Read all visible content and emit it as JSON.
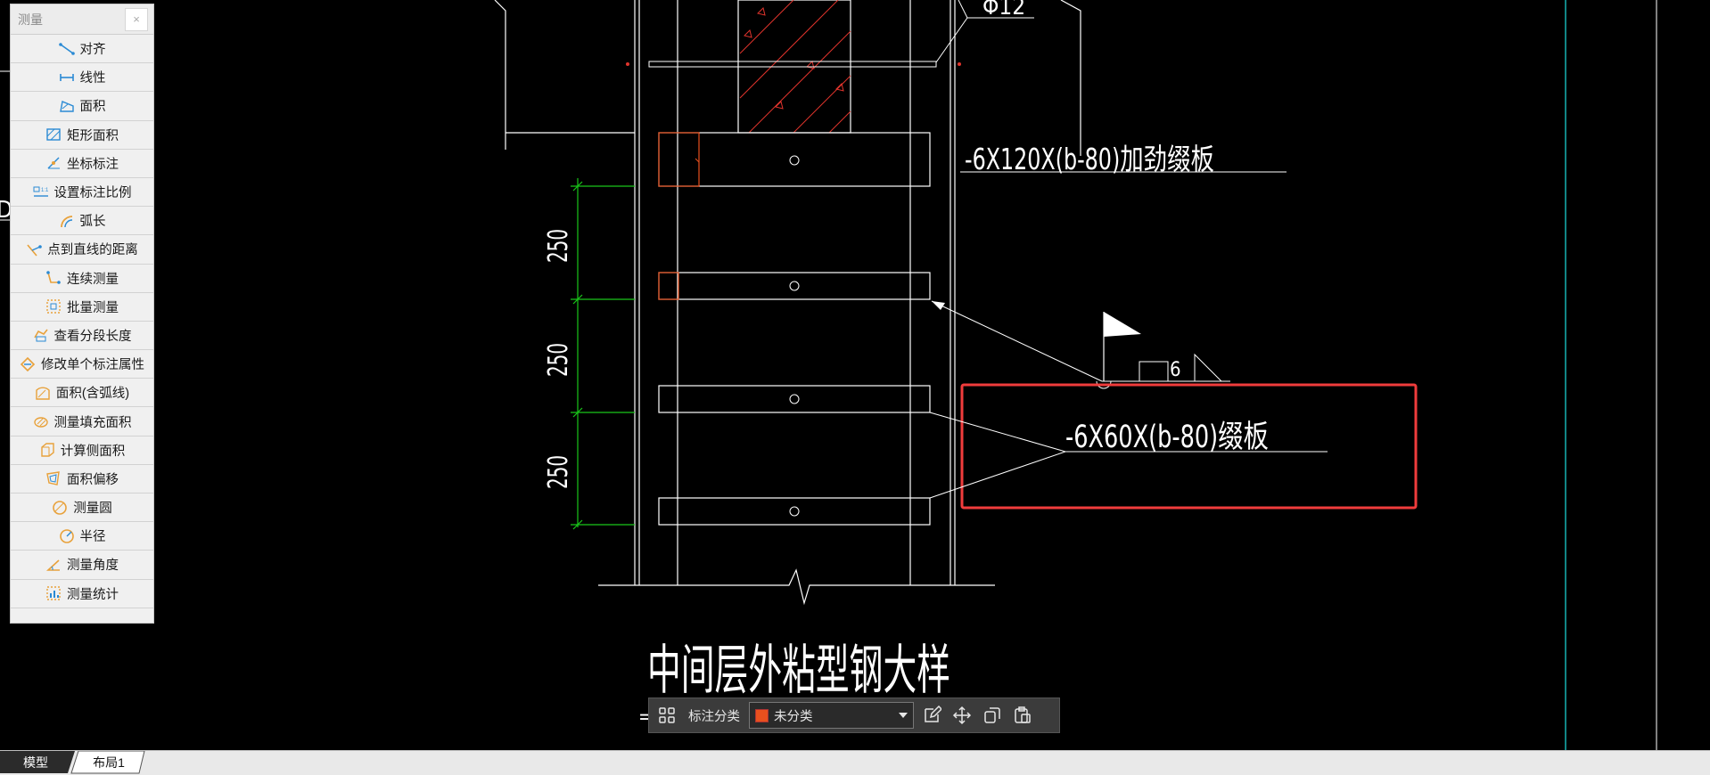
{
  "measure_panel": {
    "title": "测量",
    "close_symbol": "×",
    "tools": [
      {
        "label": "对齐",
        "icon": "align-measure-icon"
      },
      {
        "label": "线性",
        "icon": "linear-measure-icon"
      },
      {
        "label": "面积",
        "icon": "area-icon"
      },
      {
        "label": "矩形面积",
        "icon": "rect-area-icon"
      },
      {
        "label": "坐标标注",
        "icon": "coordinate-icon"
      },
      {
        "label": "设置标注比例",
        "icon": "scale-icon"
      },
      {
        "label": "弧长",
        "icon": "arc-length-icon"
      },
      {
        "label": "点到直线的距离",
        "icon": "point-line-icon"
      },
      {
        "label": "连续测量",
        "icon": "continuous-icon"
      },
      {
        "label": "批量测量",
        "icon": "batch-icon"
      },
      {
        "label": "查看分段长度",
        "icon": "segment-icon"
      },
      {
        "label": "修改单个标注属性",
        "icon": "edit-annotation-icon"
      },
      {
        "label": "面积(含弧线)",
        "icon": "arc-area-icon"
      },
      {
        "label": "测量填充面积",
        "icon": "fill-area-icon"
      },
      {
        "label": "计算侧面积",
        "icon": "side-area-icon"
      },
      {
        "label": "面积偏移",
        "icon": "area-offset-icon"
      },
      {
        "label": "测量圆",
        "icon": "circle-icon"
      },
      {
        "label": "半径",
        "icon": "radius-icon"
      },
      {
        "label": "测量角度",
        "icon": "angle-icon"
      },
      {
        "label": "测量统计",
        "icon": "statistics-icon"
      }
    ]
  },
  "drawing": {
    "label_top": "-6X120X(b-80)加劲缀板",
    "label_mid": "-6X60X(b-80)缀板",
    "dims": [
      "250",
      "250",
      "250"
    ],
    "weld_size": "6",
    "top_fragment": "Φ12",
    "title": "中间层外粘型钢大样",
    "left_fragment": "D",
    "bottom_fragment": "="
  },
  "annotation_toolbar": {
    "label": "标注分类",
    "select_value": "未分类",
    "swatch_color": "#e8501e"
  },
  "tabs": [
    {
      "label": "模型"
    },
    {
      "label": "布局1"
    }
  ],
  "colors": {
    "background": "#000000",
    "line": "#ffffff",
    "dimension": "#19c619",
    "highlight": "#f03c3c",
    "edge_cyan": "#17b3b3"
  }
}
